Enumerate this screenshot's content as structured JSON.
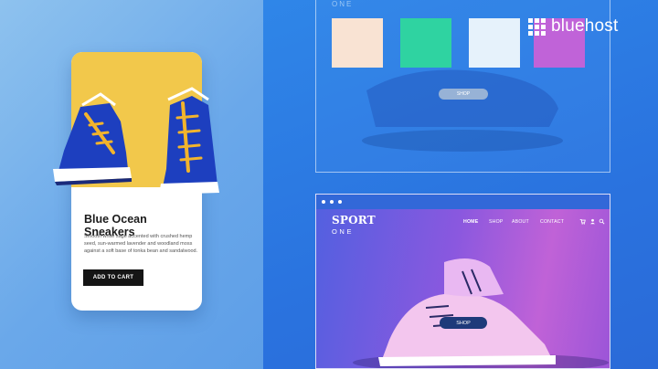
{
  "product_card": {
    "title": "Blue Ocean Sneakers",
    "description": "Smooth white sage accented with crushed hemp seed, sun-warmed lavender and woodland moss against a soft base of tonka bean and sandalwood.",
    "cart_button": "ADD TO CART"
  },
  "top_mockup": {
    "label": "ONE",
    "shop_button": "SHOP",
    "swatches": [
      "#f9e3d3",
      "#2fd3a1",
      "#e6f2fb",
      "#c063d8"
    ]
  },
  "logo": {
    "text": "bluehost",
    "icon": "bluehost-grid-icon"
  },
  "bottom_mockup": {
    "brand_line1": "SPORT",
    "brand_line2": "ONE",
    "nav": [
      "HOME",
      "SHOP",
      "ABOUT",
      "CONTACT"
    ],
    "icons": [
      "cart-icon",
      "user-icon",
      "search-icon"
    ],
    "shop_button": "SHOP"
  },
  "colors": {
    "card_photo_bg": "#f2c84b",
    "sneaker_blue": "#1d3fbf",
    "lace_yellow": "#f2b42c"
  }
}
